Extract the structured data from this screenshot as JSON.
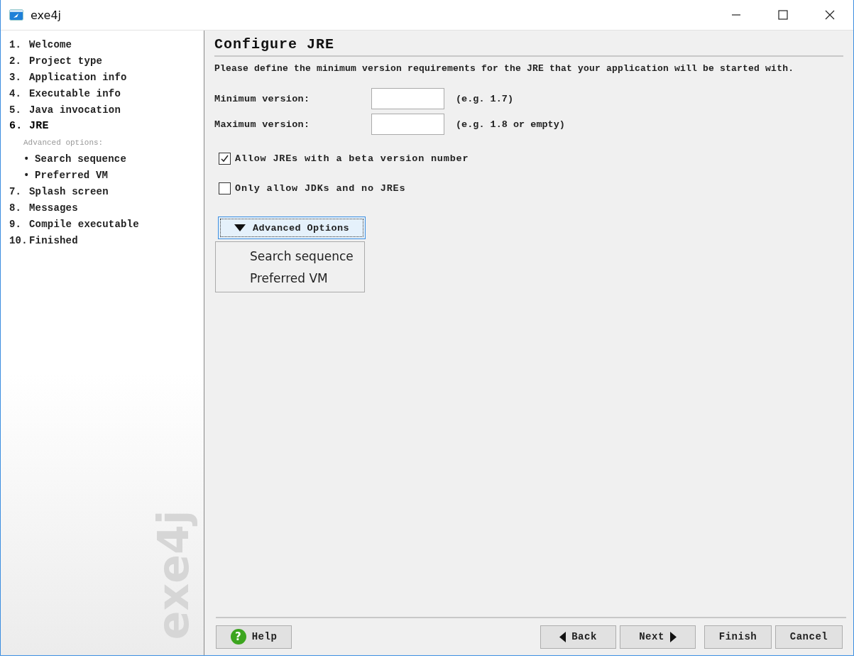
{
  "window": {
    "title": "exe4j"
  },
  "sidebar": {
    "items": [
      {
        "number": "1.",
        "label": "Welcome",
        "selected": false
      },
      {
        "number": "2.",
        "label": "Project type",
        "selected": false
      },
      {
        "number": "3.",
        "label": "Application info",
        "selected": false
      },
      {
        "number": "4.",
        "label": "Executable info",
        "selected": false
      },
      {
        "number": "5.",
        "label": "Java invocation",
        "selected": false
      },
      {
        "number": "6.",
        "label": "JRE",
        "selected": true,
        "subheading": "Advanced options:",
        "children": [
          {
            "bullet": "•",
            "label": "Search sequence"
          },
          {
            "bullet": "•",
            "label": "Preferred VM"
          }
        ]
      },
      {
        "number": "7.",
        "label": "Splash screen",
        "selected": false
      },
      {
        "number": "8.",
        "label": "Messages",
        "selected": false
      },
      {
        "number": "9.",
        "label": "Compile executable",
        "selected": false
      },
      {
        "number": "10.",
        "label": "Finished",
        "selected": false
      }
    ],
    "logo": "exe4j"
  },
  "page": {
    "title": "Configure JRE",
    "description": "Please define the minimum version requirements for the JRE that your application will be started with.",
    "fields": [
      {
        "label": "Minimum version:",
        "hint": "(e.g. 1.7)"
      },
      {
        "label": "Maximum version:",
        "hint": "(e.g. 1.8 or empty)"
      }
    ],
    "checkboxes": [
      {
        "label": "Allow JREs with a beta version number",
        "checked": true
      },
      {
        "label": "Only allow JDKs and no JREs",
        "checked": false
      }
    ],
    "advanced_button": {
      "label": "Advanced Options",
      "expanded": true
    },
    "advanced_menu": [
      "Search sequence",
      "Preferred VM"
    ]
  },
  "footer": {
    "buttons": [
      {
        "label": "Help",
        "kind": "help",
        "icon_glyph": "?"
      },
      {
        "label": "Back",
        "kind": "back"
      },
      {
        "label": "Next",
        "kind": "next"
      },
      {
        "label": "Finish",
        "kind": "plain"
      },
      {
        "label": "Cancel",
        "kind": "plain"
      }
    ]
  }
}
